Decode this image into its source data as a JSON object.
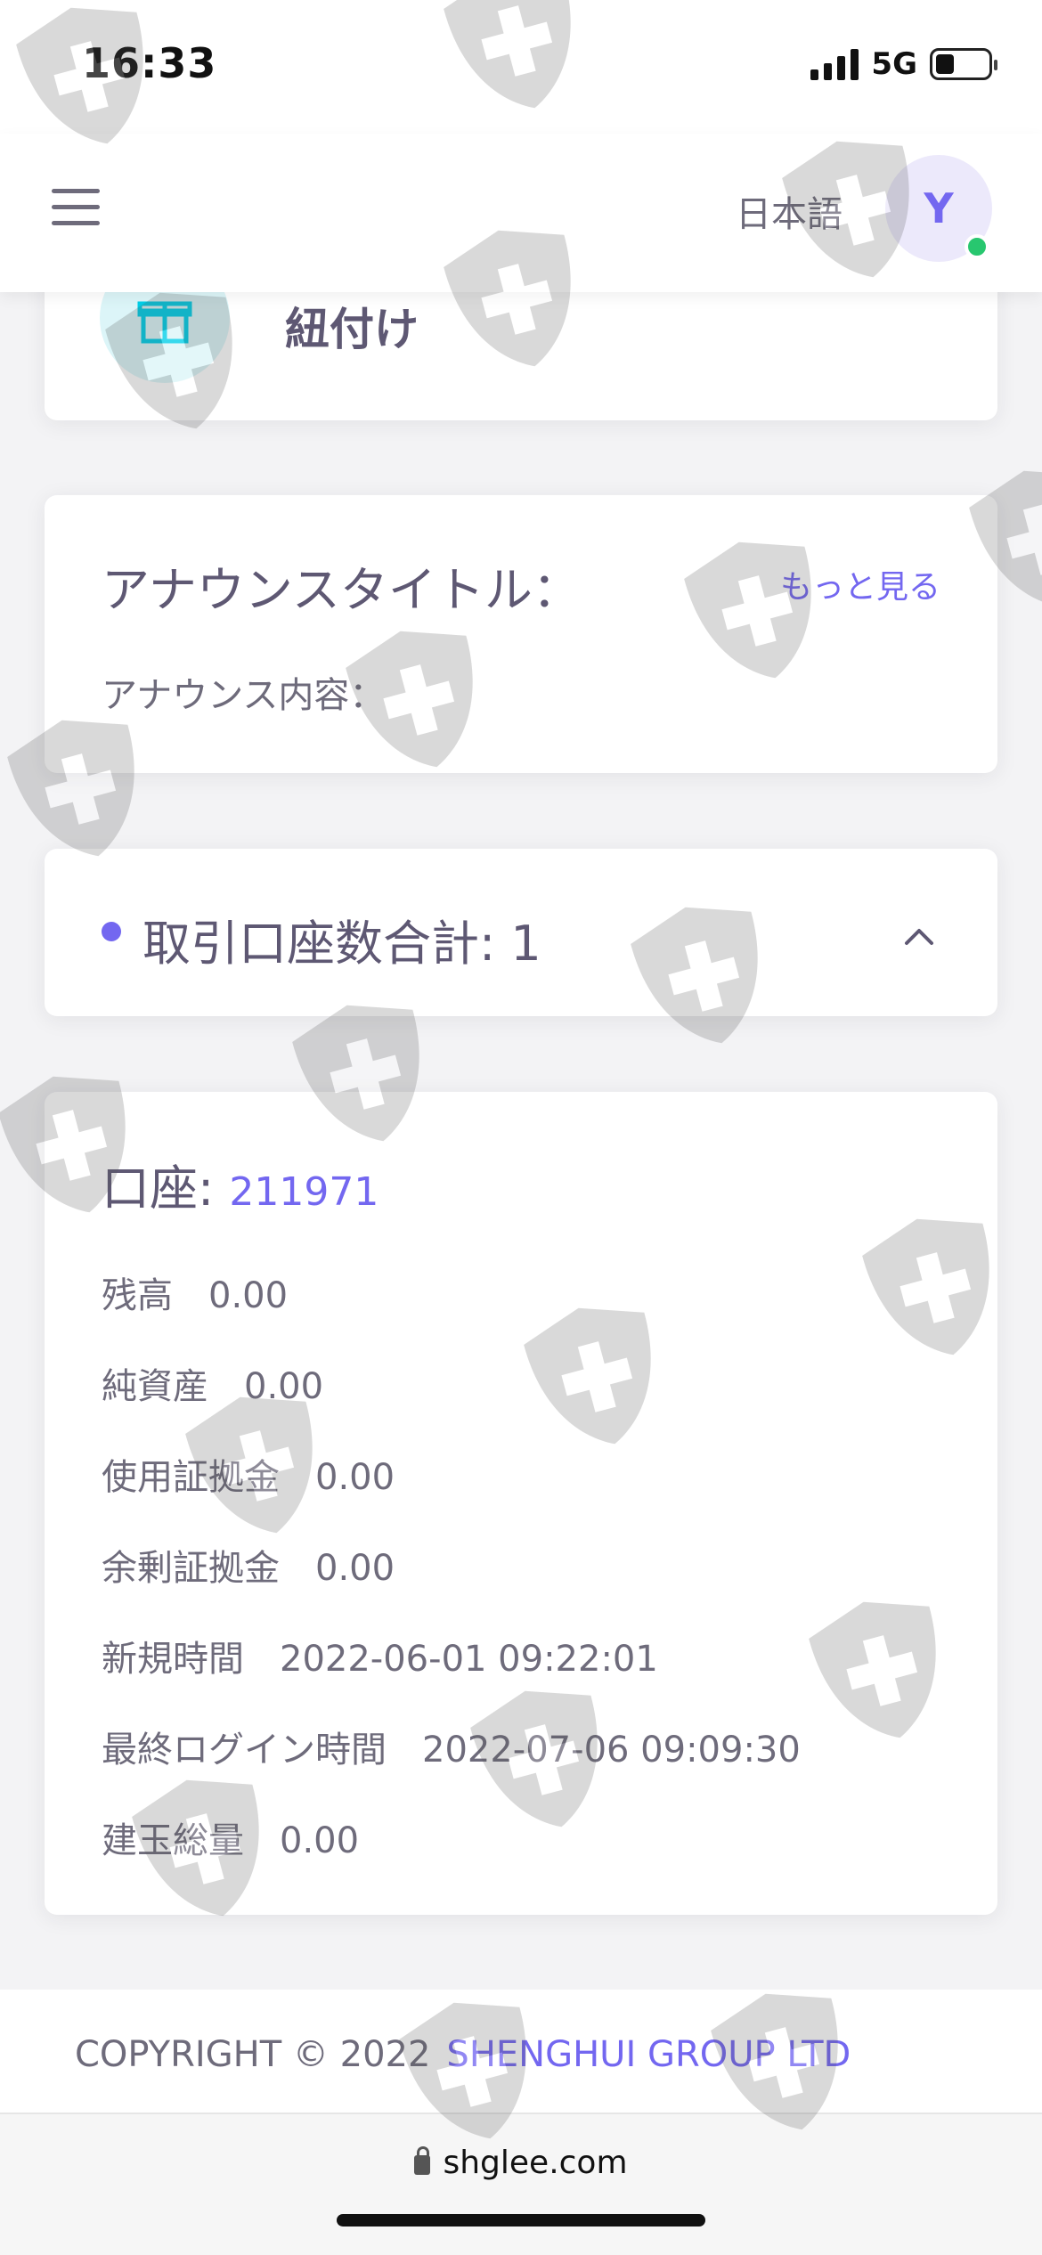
{
  "status_bar": {
    "time": "16:33",
    "network": "5G",
    "battery_level": 0.35
  },
  "header": {
    "language": "日本語",
    "avatar_initial": "Y",
    "online": true
  },
  "bind_card": {
    "title": "紐付け",
    "icon": "gift-icon"
  },
  "announcement": {
    "title": "アナウンスタイトル：",
    "more": "もっと見る",
    "content": "アナウンス内容："
  },
  "accounts": {
    "total_label": "取引口座数合計: 1",
    "expanded": true
  },
  "account_detail": {
    "label": "口座:",
    "number": "211971",
    "rows": [
      {
        "label": "残高",
        "value": "0.00"
      },
      {
        "label": "純資産",
        "value": "0.00"
      },
      {
        "label": "使用証拠金",
        "value": "0.00"
      },
      {
        "label": "余剰証拠金",
        "value": "0.00"
      },
      {
        "label": "新規時間",
        "value": "2022-06-01 09:22:01"
      },
      {
        "label": "最終ログイン時間",
        "value": "2022-07-06 09:09:30"
      },
      {
        "label": "建玉総量",
        "value": "0.00"
      }
    ]
  },
  "footer": {
    "copyright": "COPYRIGHT © 2022",
    "company": "SHENGHUI GROUP LTD"
  },
  "browser": {
    "url": "shglee.com"
  },
  "colors": {
    "accent": "#7367f0",
    "online": "#28c76f",
    "text": "#5e5873"
  }
}
